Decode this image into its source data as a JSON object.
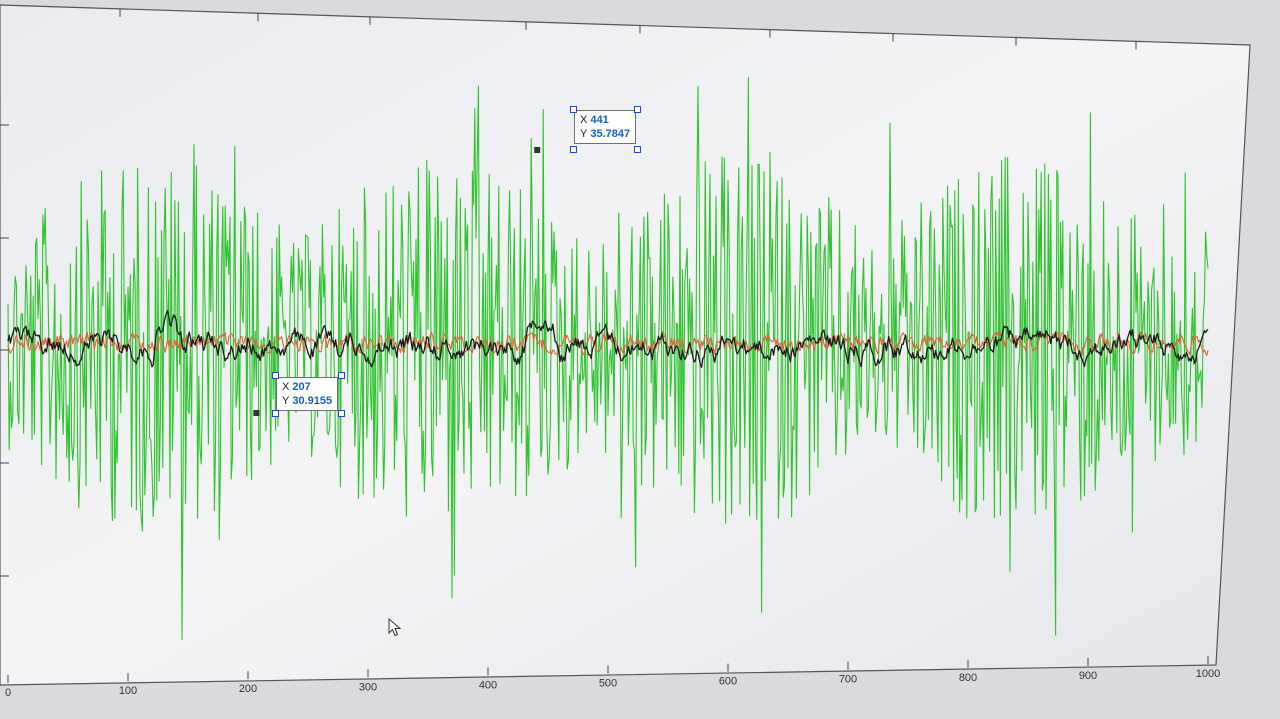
{
  "chart_data": {
    "type": "line",
    "xlim": [
      0,
      1000
    ],
    "x_ticks": [
      0,
      100,
      200,
      300,
      400,
      500,
      600,
      700,
      800,
      900,
      1000
    ],
    "x_tick_labels": [
      "0",
      "100",
      "200",
      "300",
      "400",
      "500",
      "600",
      "700",
      "800",
      "900",
      "1000"
    ],
    "grid": false,
    "legend": "none",
    "series": [
      {
        "color": "#2fc42f",
        "style": "high-amplitude oscillating signal"
      },
      {
        "color": "#e0613a",
        "style": "low-amplitude noisy signal"
      },
      {
        "color": "#1a1a1a",
        "style": "smoothed signal"
      }
    ],
    "datatips": [
      {
        "x_label": "X",
        "x_value": "441",
        "y_label": "Y",
        "y_value": "35.7847"
      },
      {
        "x_label": "X",
        "x_value": "207",
        "y_label": "Y",
        "y_value": "30.9155"
      }
    ]
  }
}
